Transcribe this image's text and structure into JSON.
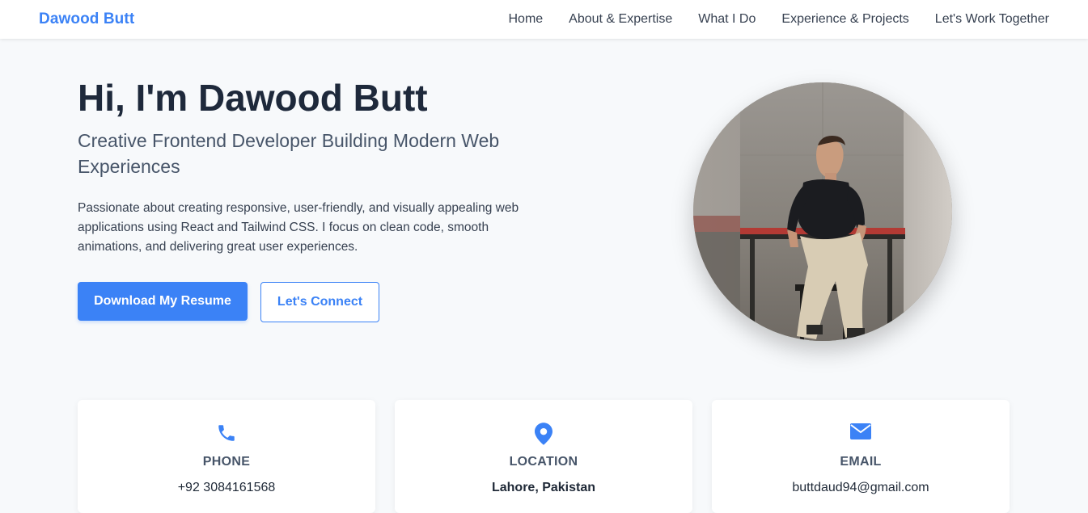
{
  "nav": {
    "brand": "Dawood Butt",
    "links": [
      "Home",
      "About & Expertise",
      "What I Do",
      "Experience & Projects",
      "Let's Work Together"
    ]
  },
  "hero": {
    "title": "Hi, I'm Dawood Butt",
    "subtitle": "Creative Frontend Developer Building Modern Web Experiences",
    "description": "Passionate about creating responsive, user-friendly, and visually appealing web applications using React and Tailwind CSS. I focus on clean code, smooth animations, and delivering great user experiences.",
    "primary_button": "Download My Resume",
    "secondary_button": "Let's Connect"
  },
  "contact_cards": [
    {
      "icon": "phone-icon",
      "label": "PHONE",
      "value": "+92 3084161568"
    },
    {
      "icon": "location-pin-icon",
      "label": "LOCATION",
      "value": "Lahore, Pakistan"
    },
    {
      "icon": "envelope-icon",
      "label": "EMAIL",
      "value": "buttdaud94@gmail.com"
    }
  ],
  "colors": {
    "accent": "#3b82f6",
    "background": "#f7f9fb",
    "heading": "#1e293b"
  }
}
